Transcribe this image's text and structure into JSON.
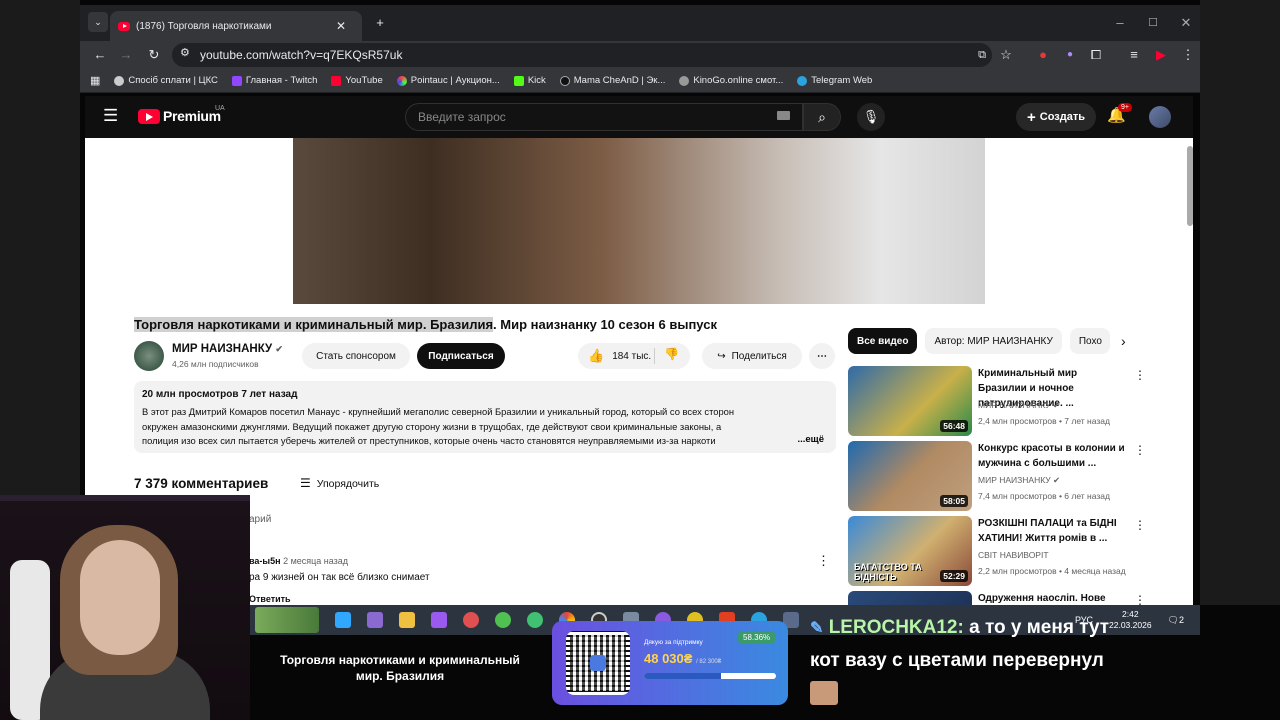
{
  "browser": {
    "tab_title": "(1876) Торговля наркотиками",
    "url": "youtube.com/watch?v=q7EKQsR57uk",
    "bookmarks": [
      "Спосіб сплати | ЦКС",
      "Главная - Twitch",
      "YouTube",
      "Pointauc | Аукцион...",
      "Kick",
      "Mama CheAnD | Эк...",
      "KinoGo.online смот...",
      "Telegram Web"
    ]
  },
  "youtube": {
    "logo": "Premium",
    "region": "UA",
    "search_placeholder": "Введите запрос",
    "create_label": "Создать",
    "notif_badge": "9+",
    "video": {
      "title_highlight": "Торговля наркотиками и криминальный мир. Бразилия",
      "title_rest": ". Мир наизнанку 10 сезон 6 выпуск",
      "channel": "МИР НАИЗНАНКУ",
      "subscribers": "4,26 млн подписчиков",
      "sponsor": "Стать спонсором",
      "subscribe": "Подписаться",
      "likes": "184 тыс.",
      "share": "Поделиться",
      "views_date": "20 млн просмотров  7 лет назад",
      "description_lines": [
        "В этот раз Дмитрий Комаров посетил Манаус - крупнейший мегаполис северной Бразилии и уникальный город, который со всех сторон",
        "окружен амазонскими джунглями. Ведущий покажет другую сторону жизни в трущобах, где действуют свои криминальные законы, а",
        "полиция изо всех сил пытается уберечь жителей от преступников, которые очень часто становятся неуправляемыми из-за наркоти"
      ],
      "more": "...ещё"
    },
    "comments": {
      "count": "7 379 комментариев",
      "sort": "Упорядочить",
      "add_placeholder": "арий",
      "first_author": "ва-ы5н",
      "first_date": "2 месяца назад",
      "first_text": "ра 9 жизней он так всё близко снимает",
      "reply": "Ответить"
    },
    "chips": [
      "Все видео",
      "Автор: МИР НАИЗНАНКУ",
      "Похо"
    ],
    "recommendations": [
      {
        "title": "Криминальный мир Бразилии и ночное патрулирование. ...",
        "channel": "МИР НАИЗНАНКУ",
        "meta": "2,4 млн просмотров • 7 лет назад",
        "duration": "56:48",
        "thumb_color": "#3a7ab8"
      },
      {
        "title": "Конкурс красоты в колонии и мужчина с большими ...",
        "channel": "МИР НАИЗНАНКУ",
        "meta": "7,4 млн просмотров • 6 лет назад",
        "duration": "58:05",
        "thumb_color": "#8a6a4a"
      },
      {
        "title": "РОЗКІШНІ ПАЛАЦИ та БІДНІ ХАТИНИ! Життя ромів в ...",
        "channel": "СВІТ НАВИВОРІТ",
        "meta": "2,2 млн просмотров • 4 месяца назад",
        "duration": "52:29",
        "thumb_color": "#4a8ad0",
        "thumb_text": "БАГАТСТВО ТА БІДНІСТЬ"
      },
      {
        "title": "Одруження наосліп. Нове",
        "channel": "",
        "meta": "",
        "duration": "",
        "thumb_color": "#2a4a7a"
      }
    ]
  },
  "taskbar": {
    "lang": "РУС",
    "time": "2:42",
    "date": "22.03.2026",
    "notif_count": "2"
  },
  "stream_overlay": {
    "title": "Торговля наркотиками и криминальный мир. Бразилия",
    "donation_label": "Дякую за підтримку",
    "donation_amount": "48 030₴",
    "donation_goal": "/ 82 300₴",
    "donation_percent": "58.36%",
    "donation_progress": 0.5836,
    "chat_user": "LEROCHKA12:",
    "chat_text": "а то у меня тут кот вазу с цветами перевернул"
  }
}
